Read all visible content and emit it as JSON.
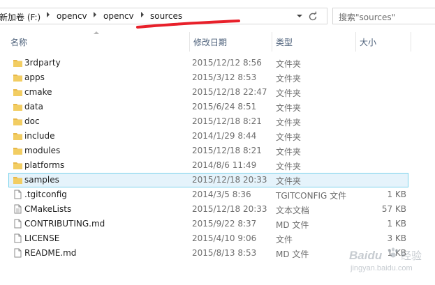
{
  "address": {
    "drive": "新加卷 (F:)",
    "crumbs": [
      "opencv",
      "opencv",
      "sources"
    ]
  },
  "search": {
    "placeholder": "搜索\"sources\""
  },
  "columns": {
    "name": "名称",
    "date": "修改日期",
    "type": "类型",
    "size": "大小"
  },
  "rows": [
    {
      "name": "3rdparty",
      "date": "2015/12/12 8:56",
      "type": "文件夹",
      "size": "",
      "kind": "folder"
    },
    {
      "name": "apps",
      "date": "2015/3/12 8:53",
      "type": "文件夹",
      "size": "",
      "kind": "folder"
    },
    {
      "name": "cmake",
      "date": "2015/12/18 22:47",
      "type": "文件夹",
      "size": "",
      "kind": "folder"
    },
    {
      "name": "data",
      "date": "2015/6/24 8:51",
      "type": "文件夹",
      "size": "",
      "kind": "folder"
    },
    {
      "name": "doc",
      "date": "2015/12/18 8:21",
      "type": "文件夹",
      "size": "",
      "kind": "folder"
    },
    {
      "name": "include",
      "date": "2014/1/29 8:44",
      "type": "文件夹",
      "size": "",
      "kind": "folder"
    },
    {
      "name": "modules",
      "date": "2015/12/18 8:21",
      "type": "文件夹",
      "size": "",
      "kind": "folder"
    },
    {
      "name": "platforms",
      "date": "2014/8/6 11:49",
      "type": "文件夹",
      "size": "",
      "kind": "folder"
    },
    {
      "name": "samples",
      "date": "2015/12/18 20:33",
      "type": "文件夹",
      "size": "",
      "kind": "folder",
      "selected": true
    },
    {
      "name": ".tgitconfig",
      "date": "2014/3/5 8:36",
      "type": "TGITCONFIG 文件",
      "size": "1 KB",
      "kind": "file"
    },
    {
      "name": "CMakeLists",
      "date": "2015/12/18 20:33",
      "type": "文本文档",
      "size": "57 KB",
      "kind": "file"
    },
    {
      "name": "CONTRIBUTING.md",
      "date": "2015/9/22 8:37",
      "type": "MD 文件",
      "size": "1 KB",
      "kind": "file"
    },
    {
      "name": "LICENSE",
      "date": "2015/4/10 9:06",
      "type": "文件",
      "size": "3 KB",
      "kind": "file"
    },
    {
      "name": "README.md",
      "date": "2015/8/13 8:53",
      "type": "MD 文件",
      "size": "1 KB",
      "kind": "file"
    }
  ],
  "watermark": {
    "brand": "Baidu",
    "text": "经验",
    "url": "jingyan.baidu.com"
  },
  "colors": {
    "folder": "#e8b84a",
    "selection_bg": "#e5f3fb",
    "selection_border": "#7ad2ec",
    "annotation": "#e8202a",
    "header_text": "#4c607a"
  },
  "icons": {
    "folder": "folder-icon",
    "file": "file-icon",
    "refresh": "refresh-icon",
    "separator": "chevron-right-icon",
    "dropdown": "chevron-down-icon",
    "search": "search-icon"
  }
}
